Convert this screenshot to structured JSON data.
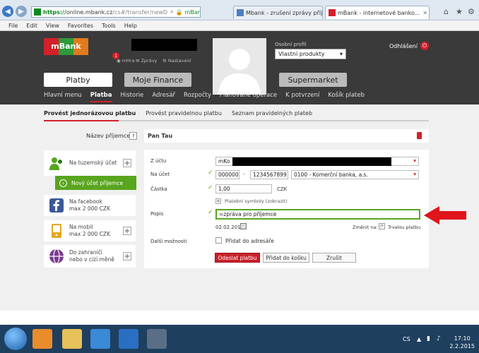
{
  "browser": {
    "url_scheme": "https://",
    "url_host": "online.mbank.cz",
    "url_rest": "/cs#/transfer/newD",
    "site_badge": "mBank S.A. [PL]",
    "tabs": [
      {
        "label": "Mbank - zrušení zprávy příjem..."
      },
      {
        "label": "mBank - internetové banko..."
      }
    ],
    "menu": [
      "File",
      "Edit",
      "View",
      "Favorites",
      "Tools",
      "Help"
    ]
  },
  "header": {
    "logo": "mBank",
    "badge_count": "1",
    "mhra": "mHra",
    "zpravy": "Zprávy",
    "nastaveni": "Nastavení",
    "profile_label": "Osobní profil",
    "profile_value": "Vlastní produkty",
    "logout": "Odhlášení",
    "big_tabs": [
      "Platby",
      "Moje Finance",
      "Supermarket"
    ],
    "nav": [
      "Hlavní menu",
      "Platba",
      "Historie",
      "Adresář",
      "Rozpočty",
      "Plánované operace",
      "K potvrzení",
      "Košík plateb"
    ]
  },
  "subtabs": [
    "Provést jednorázovou platbu",
    "Provést pravidelnou platbu",
    "Seznam pravidelných plateb"
  ],
  "recipient": {
    "label": "Název příjemce",
    "help": "?",
    "value": "Pan Tau"
  },
  "sidebar": {
    "items": [
      {
        "label": "Na tuzemský účet"
      },
      {
        "label": "Nový účet příjemce"
      },
      {
        "label": "Na facebook",
        "sub": "max 2 000 CZK"
      },
      {
        "label": "Na mobil",
        "sub": "max 2 000 CZK"
      },
      {
        "label": "Do zahraničí",
        "sub": "nebo v cizí měně"
      }
    ]
  },
  "form": {
    "from_label": "Z účtu",
    "from_value": "mKo",
    "to_label": "Na účet",
    "to_prefix": "000000",
    "to_dash": "-",
    "to_number": "1234567899",
    "to_bank": "0100 - Komerční banka, a.s.",
    "amount_label": "Částka",
    "amount_value": "1,00",
    "currency": "CZK",
    "symbols_link": "Platební symboly (zobrazit)",
    "desc_label": "Popis",
    "desc_value": "=zpráva pro příjemce",
    "date_value": "02.02.2015",
    "change_on": "Změnit na:",
    "standing": "Trvalou platbu",
    "more_label": "Další možnosti",
    "add_address": "Přidat do adresáře",
    "btn_send": "Odeslat platbu",
    "btn_basket": "Přidat do košku",
    "btn_cancel": "Zrušit"
  },
  "taskbar": {
    "lang": "CS",
    "time": "17:10",
    "date": "2.2.2015"
  },
  "colors": {
    "accent_red": "#d3202a",
    "green": "#58a51e",
    "header_bg": "#3a3a3a"
  }
}
